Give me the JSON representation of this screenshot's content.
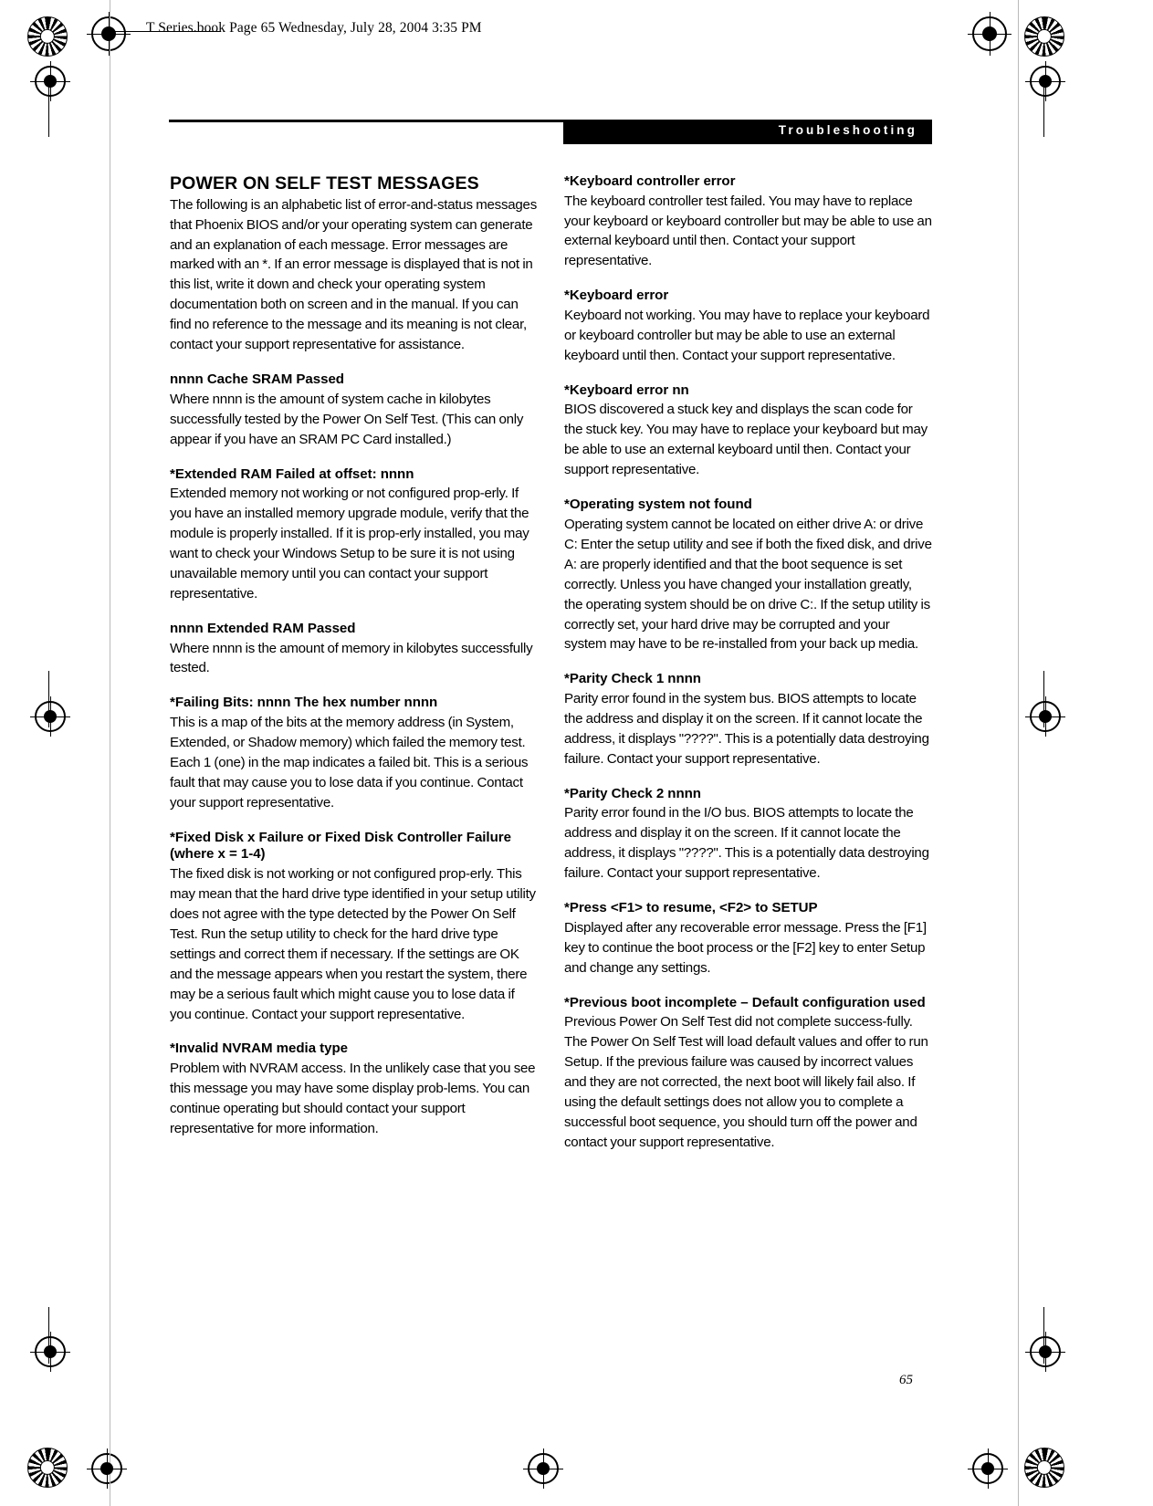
{
  "file_stamp": "T Series.book  Page 65  Wednesday, July 28, 2004  3:35 PM",
  "section_banner": "Troubleshooting",
  "page_number": "65",
  "colors": {
    "banner_bg": "#000000",
    "banner_text": "#ffffff",
    "text": "#000000",
    "paper": "#ffffff"
  },
  "left_column": {
    "title": "POWER ON SELF TEST MESSAGES",
    "intro": "The following is an alphabetic list of error-and-status messages that Phoenix BIOS and/or your operating system can generate and an explanation of each message. Error messages are marked with an *. If an error message is displayed that is not in this list, write it down and check your operating system documentation both on screen and in the manual. If you can find no reference to the message and its meaning is not clear, contact your support representative for assistance.",
    "entries": [
      {
        "term": "nnnn Cache SRAM Passed",
        "text": "Where nnnn is the amount of system cache in kilobytes successfully tested by the Power On Self Test. (This can only appear if you have an SRAM PC Card installed.)"
      },
      {
        "term": "*Extended RAM Failed at offset: nnnn",
        "text": "Extended memory not working or not configured prop-erly. If you have an installed memory upgrade module, verify that the module is properly installed. If it is prop-erly installed, you may want to check your Windows Setup to be sure it is not using unavailable memory until you can contact your support representative."
      },
      {
        "term": "nnnn Extended RAM Passed",
        "text": "Where nnnn is the amount of memory in kilobytes successfully tested."
      },
      {
        "term": "*Failing Bits: nnnn The hex number nnnn",
        "text": "This is a map of the bits at the memory address (in System, Extended, or Shadow memory) which failed the memory test. Each 1 (one) in the map indicates a failed bit. This is a serious fault that may cause you to lose data if you continue. Contact your support representative."
      },
      {
        "term": "*Fixed Disk x Failure or Fixed Disk Controller Failure (where x = 1-4)",
        "text": "The fixed disk is not working or not configured prop-erly. This may mean that the hard drive type identified in your setup utility does not agree with the type detected by the Power On Self Test. Run the setup utility to check for the hard drive type settings and correct them if necessary. If the settings are OK and the message appears when you restart the system, there may be a serious fault which might cause you to lose data if you continue. Contact your support representative."
      },
      {
        "term": "*Invalid NVRAM media type",
        "text": "Problem with NVRAM access. In the unlikely case that you see this message you may have some display prob-lems. You can continue operating but should contact your support representative for more information."
      }
    ]
  },
  "right_column": {
    "entries": [
      {
        "term": "*Keyboard controller error",
        "text": "The keyboard controller test failed. You may have to replace your keyboard or keyboard controller but may be able to use an external keyboard until then. Contact your support representative."
      },
      {
        "term": "*Keyboard error",
        "text": "Keyboard not working. You may have to replace your keyboard or keyboard controller but may be able to use an external keyboard until then. Contact your support representative."
      },
      {
        "term": "*Keyboard error nn",
        "text": "BIOS discovered a stuck key and displays the scan code for the stuck key. You may have to replace your keyboard but may be able to use an external keyboard until then. Contact your support representative."
      },
      {
        "term": "*Operating system not found",
        "text": "Operating system cannot be located on either drive A: or drive C: Enter the setup utility and see if both the fixed disk, and drive A: are properly identified and that the boot sequence is set correctly. Unless you have changed your installation greatly, the operating system should be on drive C:. If the setup utility is correctly set, your hard drive may be corrupted and your system may have to be re-installed from your back up media."
      },
      {
        "term": "*Parity Check 1 nnnn",
        "text": "Parity error found in the system bus. BIOS attempts to locate the address and display it on the screen. If it cannot locate the address, it displays \"????\". This is a potentially data destroying failure. Contact your support representative."
      },
      {
        "term": "*Parity Check 2 nnnn",
        "text": "Parity error found in the I/O bus. BIOS attempts to locate the address and display it on the screen. If it cannot locate the address, it displays \"????\". This is a potentially data destroying failure. Contact your support representative."
      },
      {
        "term": "*Press <F1> to resume, <F2> to SETUP",
        "text": "Displayed after any recoverable error message. Press the [F1] key to continue the boot process or the [F2] key to enter Setup and change any settings."
      },
      {
        "term": "*Previous boot incomplete – Default configuration used",
        "text": "Previous Power On Self Test did not complete success-fully. The Power On Self Test will load default values and offer to run Setup. If the previous failure was caused by incorrect values and they are not corrected, the next boot will likely fail also. If using the default settings does not allow you to complete a successful boot sequence, you should turn off the power and contact your support representative."
      }
    ]
  }
}
